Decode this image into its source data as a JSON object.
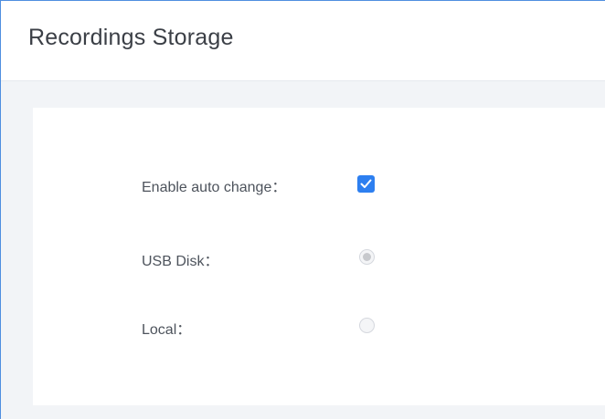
{
  "page": {
    "title": "Recordings Storage"
  },
  "form": {
    "enable_auto_change": {
      "label": "Enable auto change：",
      "checked": true
    },
    "usb_disk": {
      "label": "USB Disk：",
      "selected": true,
      "disabled": true
    },
    "local": {
      "label": "Local：",
      "selected": false,
      "disabled": true
    }
  },
  "colors": {
    "accent": "#2d7ff0",
    "frame_border": "#4f8fe0",
    "background": "#f2f4f7"
  },
  "icons": {
    "checkbox_mark": "check-icon"
  }
}
